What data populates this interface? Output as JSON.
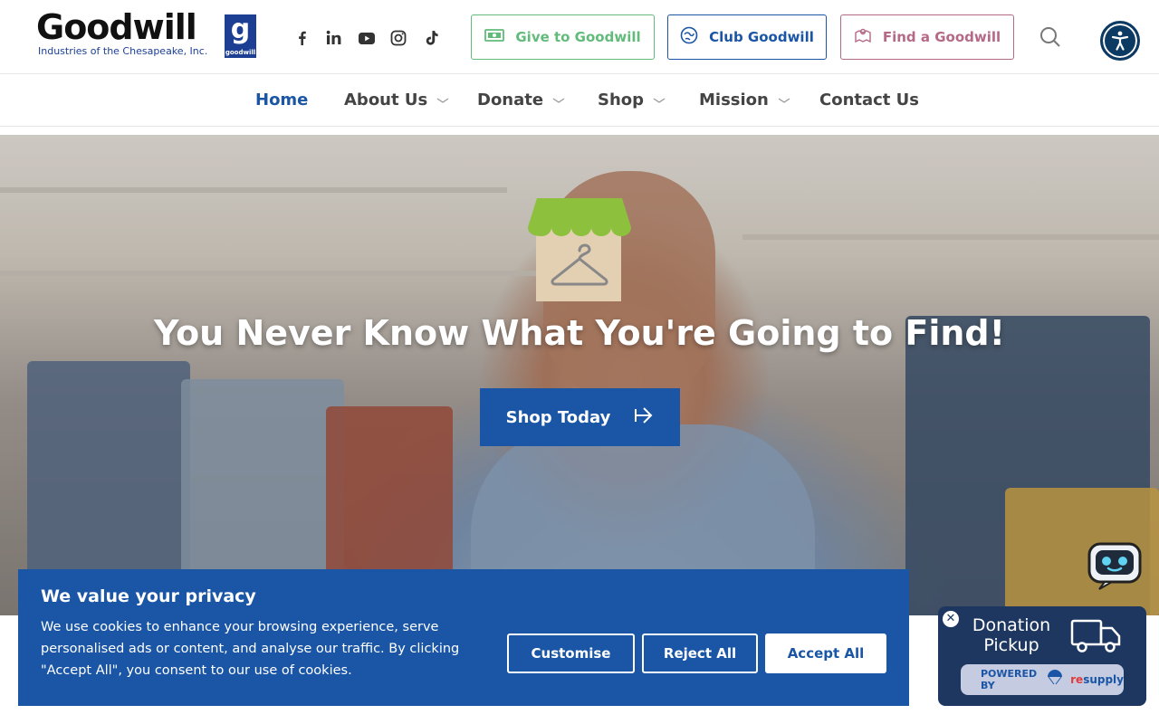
{
  "logo": {
    "name": "Goodwill",
    "badge_letter": "g",
    "badge_word": "goodwill",
    "subtitle": "Industries of the Chesapeake, Inc."
  },
  "social": [
    {
      "icon": "facebook-icon"
    },
    {
      "icon": "linkedin-icon"
    },
    {
      "icon": "youtube-icon"
    },
    {
      "icon": "instagram-icon"
    },
    {
      "icon": "tiktok-icon"
    }
  ],
  "header_buttons": {
    "give": {
      "label": "Give to Goodwill",
      "color": "#62bb7b"
    },
    "club": {
      "label": "Club Goodwill",
      "color": "#1a56a5"
    },
    "find": {
      "label": "Find a Goodwill",
      "color": "#b46a86"
    }
  },
  "nav": {
    "items": [
      {
        "label": "Home",
        "active": true,
        "has_dropdown": false
      },
      {
        "label": "About Us",
        "has_dropdown": true
      },
      {
        "label": "Donate",
        "has_dropdown": true
      },
      {
        "label": "Shop",
        "has_dropdown": true
      },
      {
        "label": "Mission",
        "has_dropdown": true
      },
      {
        "label": "Contact Us",
        "has_dropdown": false
      }
    ]
  },
  "hero": {
    "title": "You Never Know What You're Going to Find!",
    "cta_label": "Shop Today"
  },
  "cookie": {
    "title": "We value your privacy",
    "text": "We use cookies to enhance your browsing experience, serve personalised ads or content, and analyse our traffic. By clicking \"Accept All\", you consent to our use of cookies.",
    "customise_label": "Customise",
    "reject_label": "Reject All",
    "accept_label": "Accept All"
  },
  "donation_widget": {
    "title": "Donation Pickup",
    "powered_by_label": "POWERED BY",
    "partner_re": "re",
    "partner_rest": "supply"
  },
  "colors": {
    "brand_blue": "#1a56a5",
    "navy": "#1d3760",
    "accessibility": "#0c3a63"
  }
}
